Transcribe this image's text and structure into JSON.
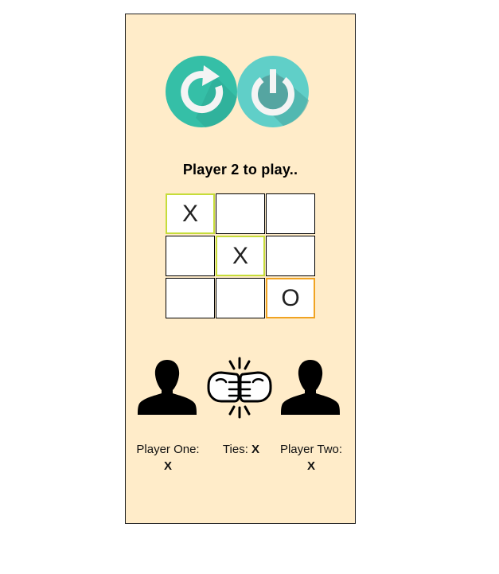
{
  "controls": {
    "restart_icon": "restart-icon",
    "power_icon": "power-icon",
    "restart_color": "#35bfa7",
    "power_color": "#60cfc8"
  },
  "status": {
    "text": "Player 2 to play.."
  },
  "board": {
    "cells": [
      {
        "value": "X",
        "highlight": "green"
      },
      {
        "value": "",
        "highlight": "none"
      },
      {
        "value": "",
        "highlight": "none"
      },
      {
        "value": "",
        "highlight": "none"
      },
      {
        "value": "X",
        "highlight": "green"
      },
      {
        "value": "",
        "highlight": "none"
      },
      {
        "value": "",
        "highlight": "none"
      },
      {
        "value": "",
        "highlight": "none"
      },
      {
        "value": "O",
        "highlight": "orange"
      }
    ],
    "highlight_colors": {
      "green": "#c6dc3a",
      "orange": "#f0a322"
    }
  },
  "scoreboard": {
    "player_one": {
      "label": "Player One:",
      "value": "X",
      "icon": "person-icon"
    },
    "ties": {
      "label": "Ties:",
      "value": "X",
      "icon": "fist-bump-icon"
    },
    "player_two": {
      "label": "Player Two:",
      "value": "X",
      "icon": "person-icon"
    }
  },
  "theme": {
    "panel_background": "#ffecc9"
  }
}
